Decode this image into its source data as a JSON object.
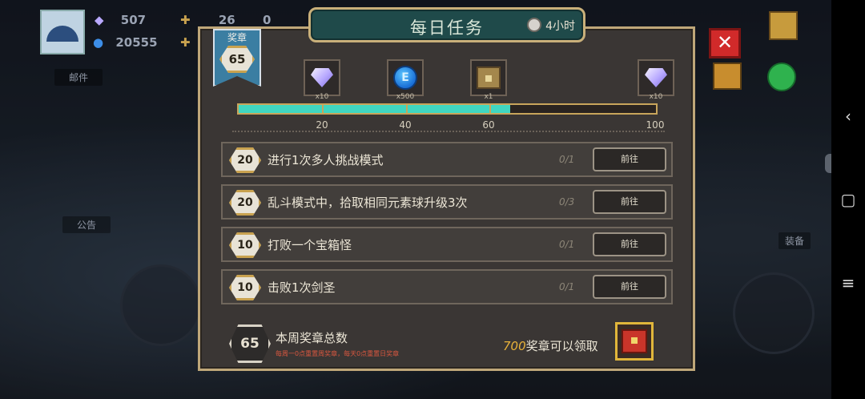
{
  "hud": {
    "gems": "507",
    "coins": "20555",
    "stat_a": "26",
    "stat_b": "0",
    "mail_label": "邮件",
    "notice_label": "公告",
    "equip_label": "装备"
  },
  "dialog": {
    "title": "每日任务",
    "timer": "4小时",
    "medal_banner_label": "奖章",
    "medal_count": "65",
    "rewards": [
      {
        "icon": "diamond-icon",
        "qty": "x10"
      },
      {
        "icon": "blue-coin-icon",
        "qty": "x500"
      },
      {
        "icon": "chest-icon",
        "qty": "x1"
      },
      {
        "icon": "diamond-icon",
        "qty": "x10"
      }
    ],
    "progress": {
      "value": 65,
      "max": 100,
      "ticks": [
        "20",
        "40",
        "60",
        "100"
      ]
    },
    "tasks": [
      {
        "points": "20",
        "text": "进行1次多人挑战模式",
        "count": "0/1",
        "button": "前往"
      },
      {
        "points": "20",
        "text": "乱斗模式中，拾取相同元素球升级3次",
        "count": "0/3",
        "button": "前往"
      },
      {
        "points": "10",
        "text": "打败一个宝箱怪",
        "count": "0/1",
        "button": "前往"
      },
      {
        "points": "10",
        "text": "击败1次剑圣",
        "count": "0/1",
        "button": "前往"
      }
    ],
    "summary": {
      "total": "65",
      "title": "本周奖章总数",
      "note": "每周一0点重置周奖章，每天0点重置日奖章",
      "claim_number": "700",
      "claim_text": "奖章可以领取"
    }
  },
  "colors": {
    "panel_bg": "#3a3634",
    "border_gold": "#c8a55b",
    "progress_fill": "#40d6c0",
    "title_bg": "#1f4a4a",
    "close_red": "#d12a2a"
  }
}
